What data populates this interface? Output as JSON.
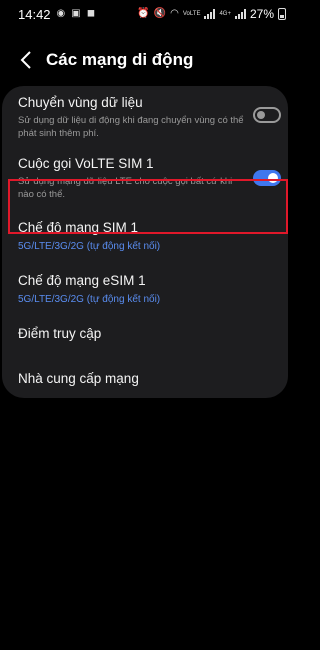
{
  "status_bar": {
    "time": "14:42",
    "battery": "27%",
    "network_labels": [
      "VoLTE",
      "4G+",
      "LTE"
    ]
  },
  "header": {
    "title": "Các mạng di động",
    "back_icon": "chevron-left-icon"
  },
  "settings": {
    "data_roaming": {
      "title": "Chuyển vùng dữ liệu",
      "description": "Sử dụng dữ liệu di động khi đang chuyển vùng có thể phát sinh thêm phí.",
      "enabled": false
    },
    "volte_sim1": {
      "title": "Cuộc gọi VoLTE SIM 1",
      "description": "Sử dụng mạng dữ liệu LTE cho cuộc gọi bất cứ khi nào có thể.",
      "enabled": true
    },
    "network_mode_sim1": {
      "title": "Chế độ mạng SIM 1",
      "value": "5G/LTE/3G/2G (tự động kết nối)"
    },
    "network_mode_esim1": {
      "title": "Chế độ mạng eSIM 1",
      "value": "5G/LTE/3G/2G (tự động kết nối)"
    },
    "access_points": {
      "title": "Điểm truy cập"
    },
    "network_operators": {
      "title": "Nhà cung cấp mạng"
    }
  },
  "colors": {
    "accent": "#3f77ee",
    "highlight": "#e0182a",
    "card_background": "#1d1d1f",
    "page_background": "#000000"
  }
}
